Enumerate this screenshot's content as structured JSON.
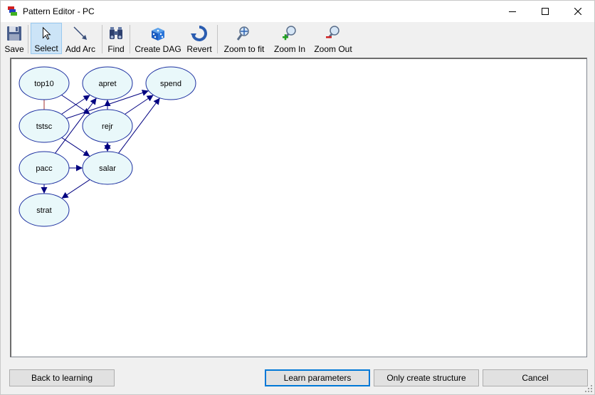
{
  "window": {
    "title": "Pattern Editor - PC"
  },
  "toolbar": {
    "save": "Save",
    "select": "Select",
    "add_arc": "Add Arc",
    "find": "Find",
    "create_dag": "Create DAG",
    "revert": "Revert",
    "zoom_fit": "Zoom to fit",
    "zoom_in": "Zoom In",
    "zoom_out": "Zoom Out",
    "active_tool": "select"
  },
  "graph": {
    "nodes": [
      {
        "id": "top10",
        "label": "top10"
      },
      {
        "id": "apret",
        "label": "apret"
      },
      {
        "id": "spend",
        "label": "spend"
      },
      {
        "id": "tstsc",
        "label": "tstsc"
      },
      {
        "id": "rejr",
        "label": "rejr"
      },
      {
        "id": "pacc",
        "label": "pacc"
      },
      {
        "id": "salar",
        "label": "salar"
      },
      {
        "id": "strat",
        "label": "strat"
      }
    ],
    "edges": [
      {
        "from": "top10",
        "to": "tstsc",
        "type": "undirected"
      },
      {
        "from": "top10",
        "to": "rejr",
        "type": "directed"
      },
      {
        "from": "tstsc",
        "to": "apret",
        "type": "directed"
      },
      {
        "from": "tstsc",
        "to": "spend",
        "type": "directed"
      },
      {
        "from": "tstsc",
        "to": "salar",
        "type": "directed"
      },
      {
        "from": "rejr",
        "to": "apret",
        "type": "directed"
      },
      {
        "from": "rejr",
        "to": "spend",
        "type": "directed"
      },
      {
        "from": "salar",
        "to": "spend",
        "type": "directed"
      },
      {
        "from": "salar",
        "to": "rejr",
        "type": "bidirected"
      },
      {
        "from": "pacc",
        "to": "salar",
        "type": "directed"
      },
      {
        "from": "pacc",
        "to": "apret",
        "type": "directed"
      },
      {
        "from": "pacc",
        "to": "strat",
        "type": "directed"
      },
      {
        "from": "salar",
        "to": "strat",
        "type": "directed"
      }
    ],
    "colors": {
      "node_fill": "#e9f8fa",
      "node_stroke": "#1c2fa0",
      "edge": "#000080",
      "undirected_edge": "#a03030"
    }
  },
  "buttons": {
    "back": "Back to learning",
    "learn": "Learn parameters",
    "structure": "Only create structure",
    "cancel": "Cancel"
  }
}
